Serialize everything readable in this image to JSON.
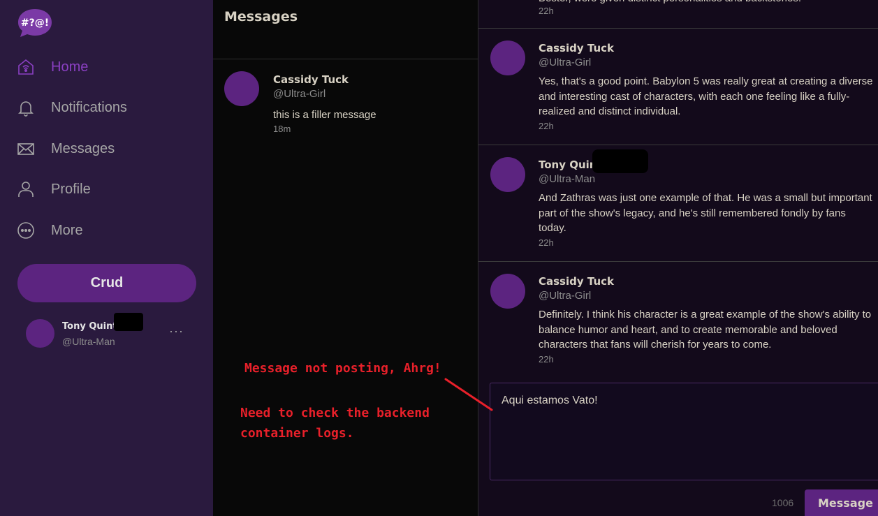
{
  "sidebar": {
    "logo_text": "#?@!",
    "nav": [
      {
        "label": "Home",
        "icon": "home-icon",
        "active": true
      },
      {
        "label": "Notifications",
        "icon": "bell-icon",
        "active": false
      },
      {
        "label": "Messages",
        "icon": "envelope-icon",
        "active": false
      },
      {
        "label": "Profile",
        "icon": "user-icon",
        "active": false
      },
      {
        "label": "More",
        "icon": "more-circle-icon",
        "active": false
      }
    ],
    "crud_label": "Crud",
    "profile": {
      "name": "Tony Quint",
      "handle": "@Ultra-Man",
      "more": "···"
    }
  },
  "messages": {
    "title": "Messages",
    "conversations": [
      {
        "name": "Cassidy Tuck",
        "handle": "@Ultra-Girl",
        "text": "this is a filler message",
        "time": "18m"
      }
    ]
  },
  "thread": {
    "top_partial": {
      "text": "Bester, were given distinct personalities and backstories.",
      "time": "22h"
    },
    "messages": [
      {
        "name": "Cassidy Tuck",
        "handle": "@Ultra-Girl",
        "text": "Yes, that's a good point. Babylon 5 was really great at creating a diverse and interesting cast of characters, with each one feeling like a fully-realized and distinct individual.",
        "time": "22h"
      },
      {
        "name": "Tony Quin",
        "handle": "@Ultra-Man",
        "text": "And Zathras was just one example of that. He was a small but important part of the show's legacy, and he's still remembered fondly by fans today.",
        "time": "22h"
      },
      {
        "name": "Cassidy Tuck",
        "handle": "@Ultra-Girl",
        "text": "Definitely. I think his character is a great example of the show's ability to balance humor and heart, and to create memorable and beloved characters that fans will cherish for years to come.",
        "time": "22h"
      }
    ],
    "composer_value": "Aqui estamos Vato!",
    "char_count": "1006",
    "send_label": "Message"
  },
  "annotations": {
    "line1": "Message not posting, Ahrg!",
    "line2": "Need to check the backend",
    "line3": "container logs."
  },
  "colors": {
    "sidebar_bg": "#2a1a3e",
    "accent": "#5c2480",
    "active_nav": "#8a3fc2",
    "annotation": "#e8202a"
  }
}
